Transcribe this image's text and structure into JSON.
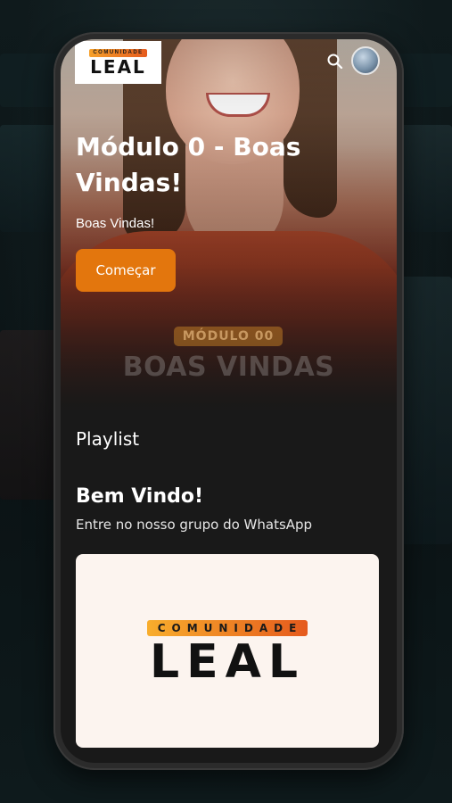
{
  "header": {
    "logo_top": "COMUNIDADE",
    "logo_main": "LEAL",
    "search_icon": "search-icon",
    "avatar_icon": "avatar"
  },
  "hero": {
    "watermark_badge": "MÓDULO 00",
    "watermark_title": "BOAS VINDAS",
    "title": "Módulo 0 - Boas Vindas!",
    "subtitle": "Boas Vindas!",
    "button_label": "Começar"
  },
  "playlist": {
    "label": "Playlist",
    "item_title": "Bem Vindo!",
    "item_description": "Entre no nosso grupo do WhatsApp",
    "card_logo_top": "COMUNIDADE",
    "card_logo_main": "LEAL"
  },
  "colors": {
    "accent": "#e3760d",
    "background": "#191919"
  }
}
